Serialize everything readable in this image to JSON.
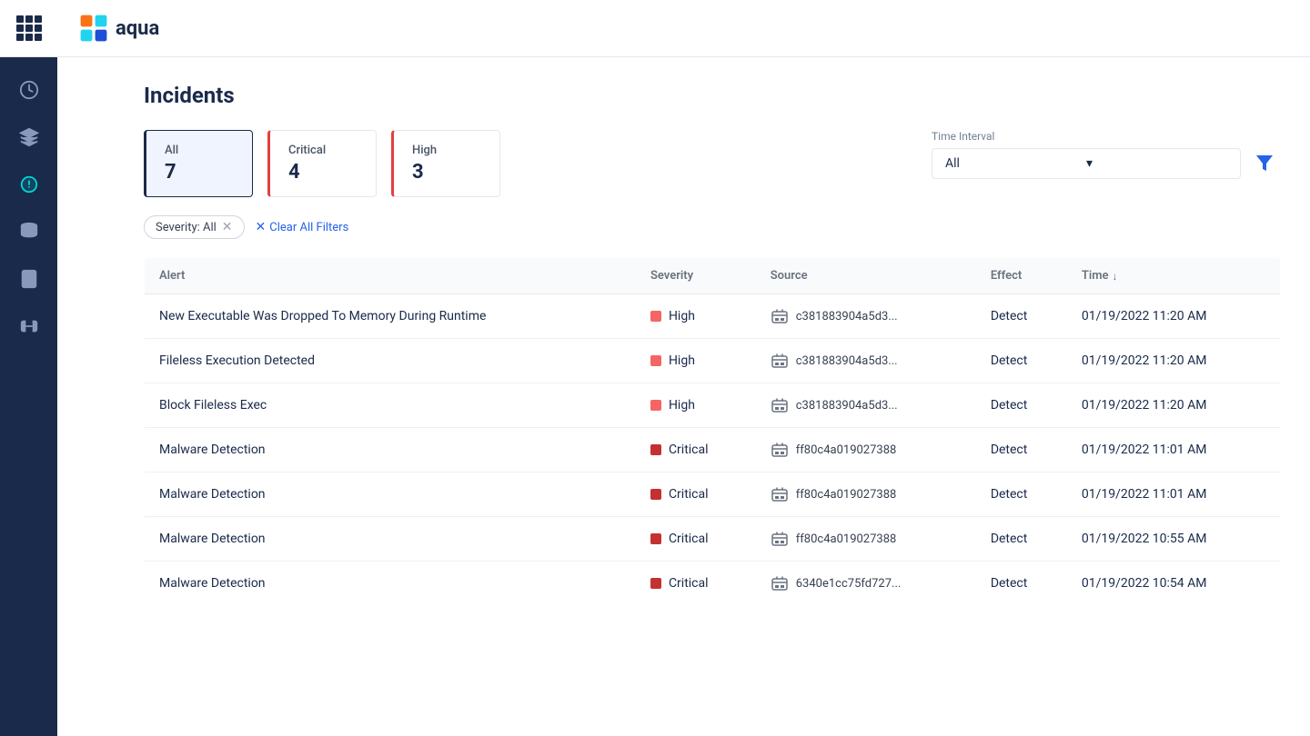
{
  "app": {
    "title": "aqua"
  },
  "page": {
    "title": "Incidents"
  },
  "summary_cards": [
    {
      "id": "all",
      "label": "All",
      "count": "7",
      "variant": "active"
    },
    {
      "id": "critical",
      "label": "Critical",
      "count": "4",
      "variant": "critical"
    },
    {
      "id": "high",
      "label": "High",
      "count": "3",
      "variant": "high"
    }
  ],
  "time_interval": {
    "label": "Time Interval",
    "value": "All",
    "placeholder": "All"
  },
  "active_filters": [
    {
      "label": "Severity: All"
    }
  ],
  "clear_all_label": "Clear All Filters",
  "table": {
    "columns": [
      {
        "id": "alert",
        "label": "Alert"
      },
      {
        "id": "severity",
        "label": "Severity"
      },
      {
        "id": "source",
        "label": "Source"
      },
      {
        "id": "effect",
        "label": "Effect"
      },
      {
        "id": "time",
        "label": "Time"
      }
    ],
    "rows": [
      {
        "alert": "New Executable Was Dropped To Memory During Runtime",
        "severity": "High",
        "severity_level": "high",
        "source": "c381883904a5d3...",
        "effect": "Detect",
        "time": "01/19/2022 11:20 AM"
      },
      {
        "alert": "Fileless Execution Detected",
        "severity": "High",
        "severity_level": "high",
        "source": "c381883904a5d3...",
        "effect": "Detect",
        "time": "01/19/2022 11:20 AM"
      },
      {
        "alert": "Block Fileless Exec",
        "severity": "High",
        "severity_level": "high",
        "source": "c381883904a5d3...",
        "effect": "Detect",
        "time": "01/19/2022 11:20 AM"
      },
      {
        "alert": "Malware Detection",
        "severity": "Critical",
        "severity_level": "critical",
        "source": "ff80c4a019027388",
        "effect": "Detect",
        "time": "01/19/2022 11:01 AM"
      },
      {
        "alert": "Malware Detection",
        "severity": "Critical",
        "severity_level": "critical",
        "source": "ff80c4a019027388",
        "effect": "Detect",
        "time": "01/19/2022 11:01 AM"
      },
      {
        "alert": "Malware Detection",
        "severity": "Critical",
        "severity_level": "critical",
        "source": "ff80c4a019027388",
        "effect": "Detect",
        "time": "01/19/2022 10:55 AM"
      },
      {
        "alert": "Malware Detection",
        "severity": "Critical",
        "severity_level": "critical",
        "source": "6340e1cc75fd727...",
        "effect": "Detect",
        "time": "01/19/2022 10:54 AM"
      }
    ]
  },
  "sidebar": {
    "items": [
      {
        "id": "dashboard",
        "icon": "dashboard",
        "active": false
      },
      {
        "id": "workloads",
        "icon": "workloads",
        "active": false
      },
      {
        "id": "incidents",
        "icon": "incidents",
        "active": true
      },
      {
        "id": "layers",
        "icon": "layers",
        "active": false
      },
      {
        "id": "reports",
        "icon": "reports",
        "active": false
      },
      {
        "id": "integrations",
        "icon": "integrations",
        "active": false
      }
    ]
  }
}
